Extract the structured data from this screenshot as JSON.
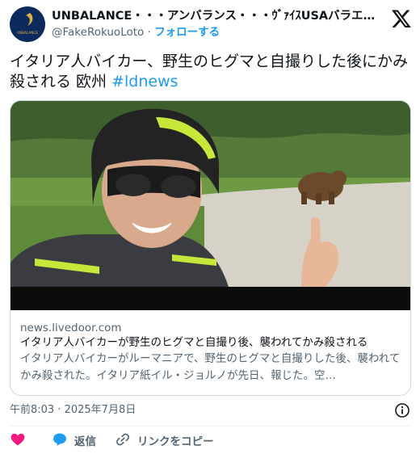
{
  "author": {
    "display_name": "UNBALANCE・・・アンバランス・・・ｳﾞｧｲｽUSAバラエティー…",
    "handle": "@FakeRokuoLoto",
    "separator": "·",
    "follow_label": "フォローする",
    "avatar_text": "UNBALANCE"
  },
  "tweet": {
    "text_main": "イタリア人バイカー、野生のヒグマと自撮りした後にかみ殺される 欧州 ",
    "hashtag": "#ldnews"
  },
  "card": {
    "domain": "news.livedoor.com",
    "title": "イタリア人バイカーが野生のヒグマと自撮り後、襲われてかみ殺される",
    "description": "イタリア人バイカーがルーマニアで、野生のヒグマと自撮りした後、襲われてかみ殺された。イタリア紙イル・ジョルノが先日、報じた。空…"
  },
  "meta": {
    "timestamp": "午前8:03 · 2025年7月8日"
  },
  "actions": {
    "reply_label": "返信",
    "copy_link_label": "リンクをコピー"
  },
  "colors": {
    "accent": "#1d9bf0",
    "like": "#f91880",
    "text": "#0f1419",
    "muted": "#536471"
  },
  "icons": [
    "x-logo-icon",
    "info-icon",
    "heart-icon",
    "reply-bubble-icon",
    "link-icon"
  ]
}
